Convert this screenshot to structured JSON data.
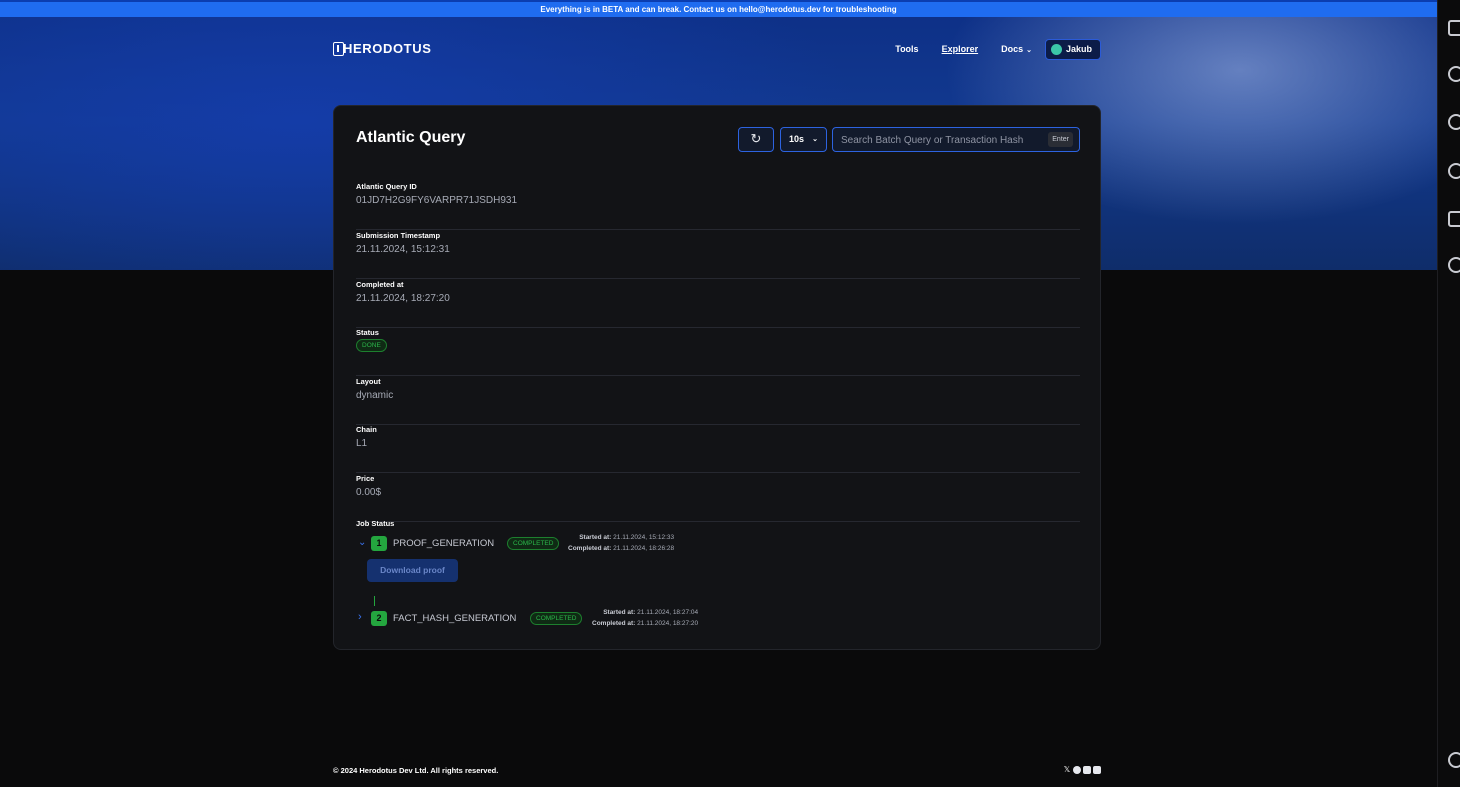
{
  "banner": {
    "text": "Everything is in BETA and can break. Contact us on hello@herodotus.dev for troubleshooting"
  },
  "nav": {
    "logo": "HERODOTUS",
    "links": [
      {
        "label": "Tools"
      },
      {
        "label": "Explorer"
      },
      {
        "label": "Docs"
      }
    ],
    "user": "Jakub"
  },
  "card": {
    "title": "Atlantic Query",
    "interval": "10s",
    "search_placeholder": "Search Batch Query or Transaction Hash",
    "enter_label": "Enter"
  },
  "fields": [
    {
      "label": "Atlantic Query ID",
      "value": "01JD7H2G9FY6VARPR71JSDH931"
    },
    {
      "label": "Submission Timestamp",
      "value": "21.11.2024, 15:12:31"
    },
    {
      "label": "Completed at",
      "value": "21.11.2024, 18:27:20"
    },
    {
      "label": "Status",
      "value": "DONE"
    },
    {
      "label": "Layout",
      "value": "dynamic"
    },
    {
      "label": "Chain",
      "value": "L1"
    },
    {
      "label": "Price",
      "value": "0.00$"
    }
  ],
  "job_status": {
    "title": "Job Status",
    "download_label": "Download proof",
    "started_label": "Started at:",
    "completed_label": "Completed at:",
    "jobs": [
      {
        "num": "1",
        "name": "PROOF_GENERATION",
        "status": "COMPLETED",
        "started": "21.11.2024, 15:12:33",
        "completed": "21.11.2024, 18:26:28"
      },
      {
        "num": "2",
        "name": "FACT_HASH_GENERATION",
        "status": "COMPLETED",
        "started": "21.11.2024, 18:27:04",
        "completed": "21.11.2024, 18:27:20"
      }
    ]
  },
  "footer": {
    "copyright": "© 2024 Herodotus Dev Ltd. All rights reserved."
  },
  "colors": {
    "accent": "#2d63e0",
    "success": "#24a63f",
    "card_bg": "#121316"
  }
}
